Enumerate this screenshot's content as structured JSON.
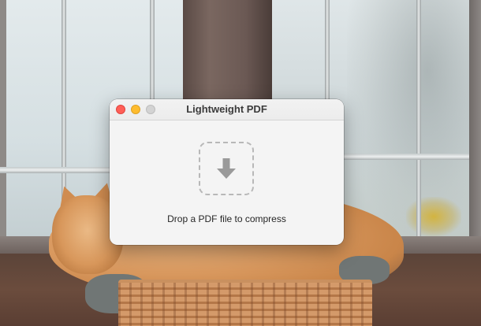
{
  "window": {
    "title": "Lightweight PDF",
    "controls": {
      "close": "close-button",
      "minimize": "minimize-button",
      "zoom": "zoom-button"
    }
  },
  "drop_zone": {
    "icon": "download-arrow-icon",
    "message": "Drop a PDF file to compress"
  },
  "colors": {
    "close": "#ff5f57",
    "minimize": "#febc2e",
    "zoom_inactive": "#d3d3d3",
    "window_background": "#f4f4f4",
    "drop_zone_border": "#b8b8b8",
    "icon": "#9a9a9a"
  },
  "wallpaper": {
    "icon": "desktop-wallpaper"
  }
}
